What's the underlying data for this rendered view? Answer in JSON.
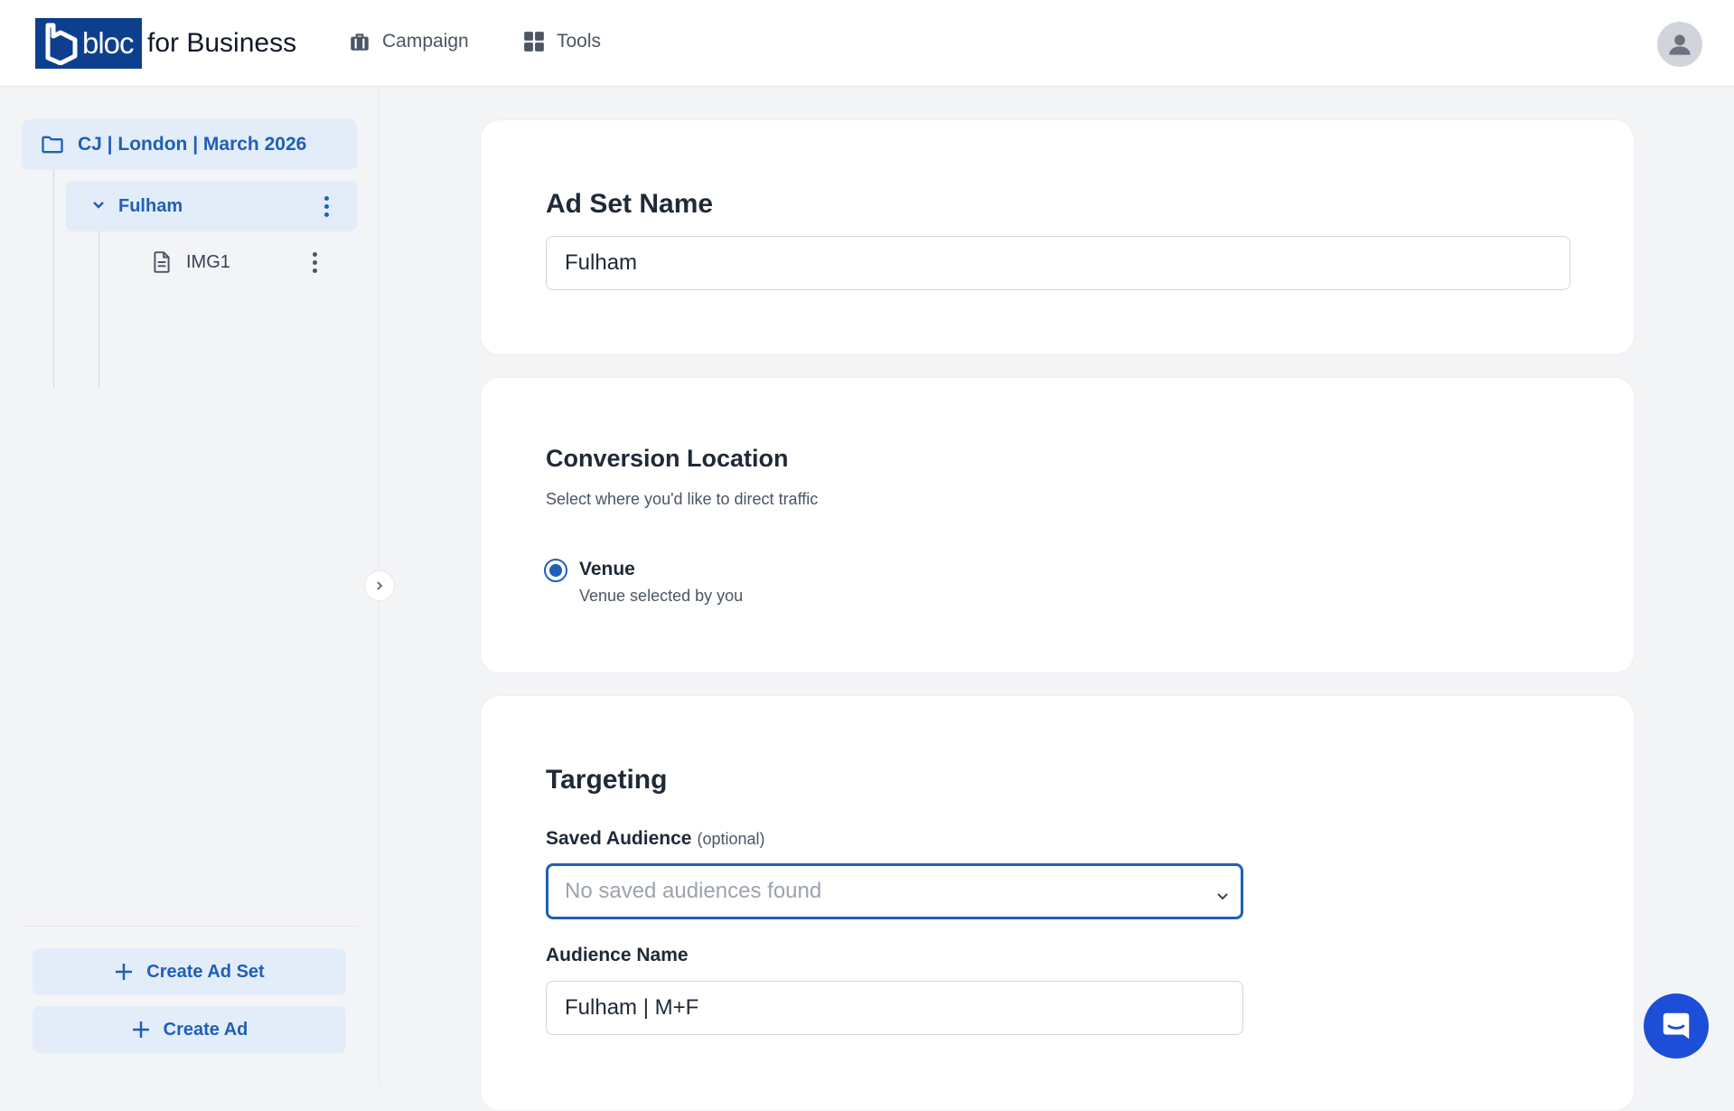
{
  "header": {
    "logo_word": "bloc",
    "logo_suffix": "for Business",
    "nav": [
      {
        "label": "Campaign",
        "icon": "briefcase-icon"
      },
      {
        "label": "Tools",
        "icon": "grid-icon"
      }
    ]
  },
  "sidebar": {
    "campaign": {
      "label": "CJ | London | March 2026",
      "icon": "folder-icon"
    },
    "adset": {
      "label": "Fulham",
      "icon": "chevron-down-icon"
    },
    "ad": {
      "label": "IMG1",
      "icon": "document-icon"
    },
    "buttons": {
      "create_ad_set": "Create Ad Set",
      "create_ad": "Create Ad"
    }
  },
  "main": {
    "ad_set_name": {
      "title": "Ad Set Name",
      "value": "Fulham"
    },
    "conversion": {
      "title": "Conversion Location",
      "subtitle": "Select where you'd like to direct traffic",
      "option_label": "Venue",
      "option_desc": "Venue selected by you",
      "selected": true
    },
    "targeting": {
      "title": "Targeting",
      "saved_audience_label": "Saved Audience",
      "saved_audience_optional": "(optional)",
      "saved_audience_placeholder": "No saved audiences found",
      "audience_name_label": "Audience Name",
      "audience_name_value": "Fulham | M+F"
    }
  },
  "colors": {
    "brand": "#0d3f8f",
    "accent": "#1f5fb7",
    "chat": "#1d4ed8"
  }
}
